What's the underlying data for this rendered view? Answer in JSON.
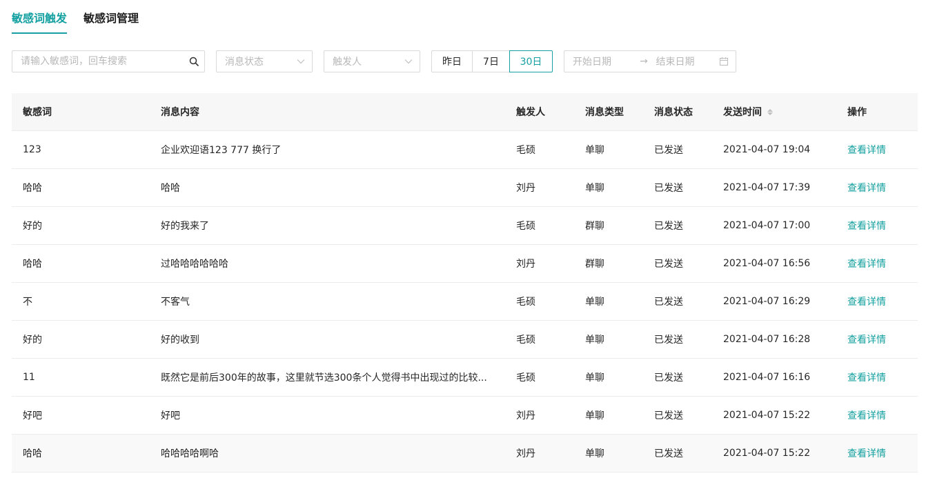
{
  "tabs": [
    {
      "label": "敏感词触发",
      "active": true
    },
    {
      "label": "敏感词管理",
      "active": false
    }
  ],
  "filters": {
    "search_placeholder": "请输入敏感词，回车搜索",
    "status_placeholder": "消息状态",
    "trigger_placeholder": "触发人",
    "range_buttons": [
      {
        "label": "昨日",
        "active": false
      },
      {
        "label": "7日",
        "active": false
      },
      {
        "label": "30日",
        "active": true
      }
    ],
    "start_date_placeholder": "开始日期",
    "range_arrow": "→",
    "end_date_placeholder": "结束日期"
  },
  "table": {
    "headers": [
      "敏感词",
      "消息内容",
      "触发人",
      "消息类型",
      "消息状态",
      "发送时间",
      "操作"
    ],
    "rows": [
      {
        "word": "123",
        "content": "企业欢迎语123 777 换行了",
        "trigger": "毛硕",
        "type": "单聊",
        "status": "已发送",
        "time": "2021-04-07 19:04",
        "action": "查看详情"
      },
      {
        "word": "哈哈",
        "content": "哈哈",
        "trigger": "刘丹",
        "type": "单聊",
        "status": "已发送",
        "time": "2021-04-07 17:39",
        "action": "查看详情"
      },
      {
        "word": "好的",
        "content": "好的我来了",
        "trigger": "毛硕",
        "type": "群聊",
        "status": "已发送",
        "time": "2021-04-07 17:00",
        "action": "查看详情"
      },
      {
        "word": "哈哈",
        "content": "过哈哈哈哈哈哈",
        "trigger": "刘丹",
        "type": "群聊",
        "status": "已发送",
        "time": "2021-04-07 16:56",
        "action": "查看详情"
      },
      {
        "word": "不",
        "content": "不客气",
        "trigger": "毛硕",
        "type": "单聊",
        "status": "已发送",
        "time": "2021-04-07 16:29",
        "action": "查看详情"
      },
      {
        "word": "好的",
        "content": "好的收到",
        "trigger": "毛硕",
        "type": "单聊",
        "status": "已发送",
        "time": "2021-04-07 16:28",
        "action": "查看详情"
      },
      {
        "word": "11",
        "content": "既然它是前后300年的故事，这里就节选300条个人觉得书中出现过的比较...",
        "trigger": "毛硕",
        "type": "单聊",
        "status": "已发送",
        "time": "2021-04-07 16:16",
        "action": "查看详情"
      },
      {
        "word": "好吧",
        "content": "好吧",
        "trigger": "刘丹",
        "type": "单聊",
        "status": "已发送",
        "time": "2021-04-07 15:22",
        "action": "查看详情"
      },
      {
        "word": "哈哈",
        "content": "哈哈哈哈啊哈",
        "trigger": "刘丹",
        "type": "单聊",
        "status": "已发送",
        "time": "2021-04-07 15:22",
        "action": "查看详情"
      }
    ]
  },
  "colors": {
    "accent": "#14a0a0",
    "border": "#d9d9d9",
    "header_bg": "#f7f7f7"
  },
  "icons": {
    "search": "search-icon",
    "select_arrow": "chevron-down-icon",
    "date": "calendar-icon",
    "sort": "sort-icon"
  }
}
